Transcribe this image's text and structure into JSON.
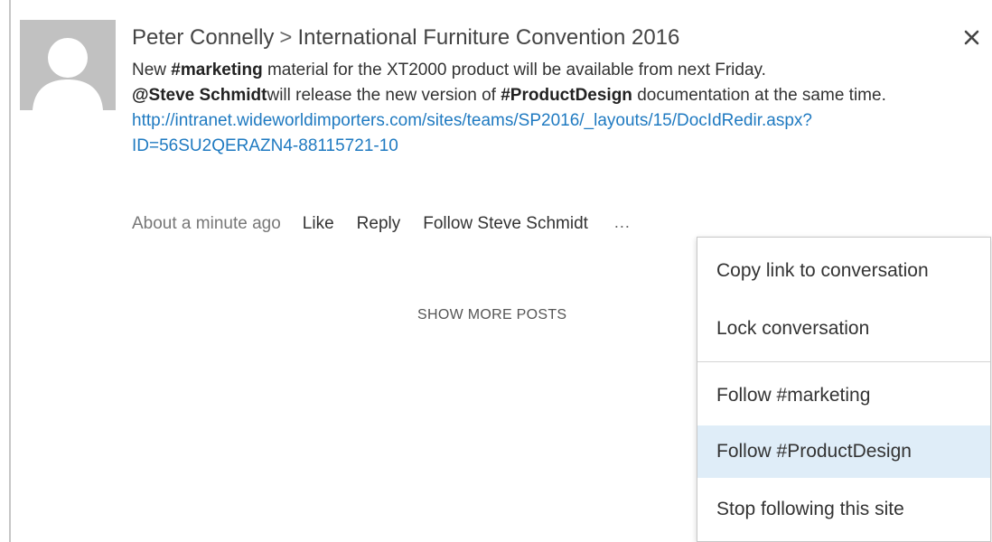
{
  "post": {
    "author": "Peter Connelly",
    "separator": ">",
    "site": "International Furniture Convention 2016",
    "body": {
      "t1": "New ",
      "tag1": "#marketing",
      "t2": " material for the XT2000 product will be available from next Friday.",
      "mention": "@Steve Schmidt",
      "t3": "will release the new version of ",
      "tag2": "#ProductDesign",
      "t4": " documentation at the same time."
    },
    "link_line1": "http://intranet.wideworldimporters.com/sites/teams/SP2016/_layouts/15/DocIdRedir.aspx?",
    "link_line2": "ID=56SU2QERAZN4-88115721-10",
    "timestamp": "About a minute ago",
    "actions": {
      "like": "Like",
      "reply": "Reply",
      "follow": "Follow Steve Schmidt",
      "more": "..."
    }
  },
  "show_more_label": "SHOW MORE POSTS",
  "menu": {
    "items": [
      {
        "label": "Copy link to conversation"
      },
      {
        "label": "Lock conversation"
      },
      {
        "label": "Follow #marketing"
      },
      {
        "label": "Follow #ProductDesign"
      },
      {
        "label": "Stop following this site"
      }
    ]
  },
  "icons": {
    "avatar": "person-silhouette-icon",
    "close": "close-icon"
  },
  "colors": {
    "link": "#1f7ac1",
    "menu_highlight": "#dfedf8",
    "avatar_bg": "#c1c1c1"
  }
}
